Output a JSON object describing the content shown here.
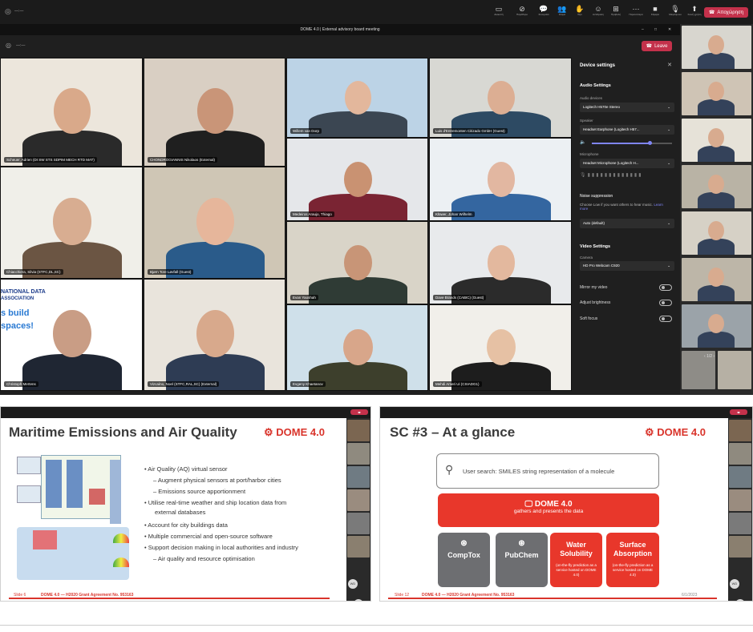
{
  "top_bar": {
    "tools": [
      {
        "icon": "screen-icon",
        "label": "Διακοπή"
      },
      {
        "icon": "block-icon",
        "label": "Παράθυρο"
      },
      {
        "icon": "chat-icon",
        "label": "Συνομιλία"
      },
      {
        "icon": "people-icon",
        "label": "Άτομα"
      },
      {
        "icon": "hand-icon",
        "label": "Χέρι"
      },
      {
        "icon": "react-icon",
        "label": "Αντίδραση"
      },
      {
        "icon": "view-icon",
        "label": "Προβολή"
      },
      {
        "icon": "more-icon",
        "label": "Περισσότερα"
      },
      {
        "icon": "camera-icon",
        "label": "Κάμερα"
      },
      {
        "icon": "mic-icon",
        "label": "Μικρόφωνο"
      },
      {
        "icon": "share-icon",
        "label": "Κοινή χρήση"
      }
    ],
    "leave_label": "Αποχώρηση",
    "timer": "—:—"
  },
  "meeting": {
    "title": "DOME 4.0 | External advisory board meeting",
    "timer": "—:—",
    "toolbar": [
      {
        "icon": "chat-icon",
        "label": "Chat"
      },
      {
        "icon": "people-icon",
        "label": "People"
      },
      {
        "icon": "hand-icon",
        "label": "Raise"
      },
      {
        "icon": "react-icon",
        "label": "React"
      },
      {
        "icon": "view-icon",
        "label": "View"
      },
      {
        "icon": "more-icon",
        "label": "More"
      },
      {
        "icon": "camera-icon",
        "label": "Camera"
      },
      {
        "icon": "mic-icon",
        "label": "Mic"
      },
      {
        "icon": "share-icon",
        "label": "Stop sharing"
      }
    ],
    "leave_label": "Leave",
    "participants": [
      "Scheuer, Adrien (DI SW STS SDPIM MECH RTD MAT)",
      "CHONDROGIANNIS Nikolaos (External)",
      "Willem van Dorp",
      "Luis d'Entremonten Citizado GmbH (Guest)",
      "Chiacchiera, Silvia (STFC,DL,SC)",
      "Bjørn Tore Løvfall (Guest)",
      "Medeiros Araujo, Thiago",
      "Klüwer, Johan Wilhelm",
      "Christoph Mertens",
      "Vizcaíno, Noel (STFC,RAL,SC) (External)",
      "Evan Yaoshah",
      "Dave Brands (CABIC) (Guest)",
      "Evgeny Khaetanov",
      "Mehdi Ameri Ui (CSIADG1)"
    ],
    "slide_text": [
      "NATIONAL DATA",
      "ASSOCIATION",
      "s build",
      "spaces!"
    ],
    "pager": "1/2"
  },
  "device_settings": {
    "title": "Device settings",
    "audio_heading": "Audio Settings",
    "audio_devices_label": "Audio devices",
    "audio_device_value": "Logitech H570e Stereo",
    "speaker_label": "Speaker",
    "speaker_value": "Headset Earphone (Logitech H57...",
    "microphone_label": "Microphone",
    "microphone_value": "Headset Microphone (Logitech H...",
    "noise_label": "Noise suppression",
    "noise_desc": "Choose Low if you want others to hear music.",
    "noise_link": "Learn more",
    "noise_value": "Auto (default)",
    "video_heading": "Video Settings",
    "camera_label": "Camera",
    "camera_value": "HD Pro Webcam C920",
    "mirror_label": "Mirror my video",
    "brightness_label": "Adjust brightness",
    "soft_focus_label": "Soft focus"
  },
  "slides": [
    {
      "title": "Maritime Emissions and Air Quality",
      "logo": "DOME 4.0",
      "bullets": [
        "Air Quality (AQ) virtual sensor",
        "– Augment physical sensors at port/harbor cities",
        "– Emissions source apportionment",
        "Utilise real-time weather and ship location data  from",
        "external databases",
        "Account for city buildings data",
        "Multiple commercial and open-source software",
        "Support decision making in local authorities and industry",
        "– Air quality and resource optimisation"
      ],
      "slide_no": "Slide 6",
      "footer": "DOME 4.0 — H2020 Grant Agreement No. 953163",
      "initials": [
        "WD",
        "CN"
      ]
    },
    {
      "title": "SC #3 – At a glance",
      "logo": "DOME 4.0",
      "search_text": "User search: SMILES string representation of a molecule",
      "dome_box_title": "DOME 4.0",
      "dome_box_sub": "gathers and presents the data",
      "sources": [
        "CompTox",
        "PubChem"
      ],
      "water_title": "Water Solubility",
      "water_sub": "(on-the-fly prediction as a service hosted on DOME 4.0)",
      "surface_title": "Surface Absorption",
      "surface_sub": "(on-the-fly prediction as a service hosted on DOME 4.0)",
      "slide_no": "Slide 12",
      "footer": "DOME 4.0 — H2020 Grant Agreement No. 953163",
      "date": "6/1/2023",
      "initials": [
        "WD",
        "CN"
      ]
    }
  ]
}
